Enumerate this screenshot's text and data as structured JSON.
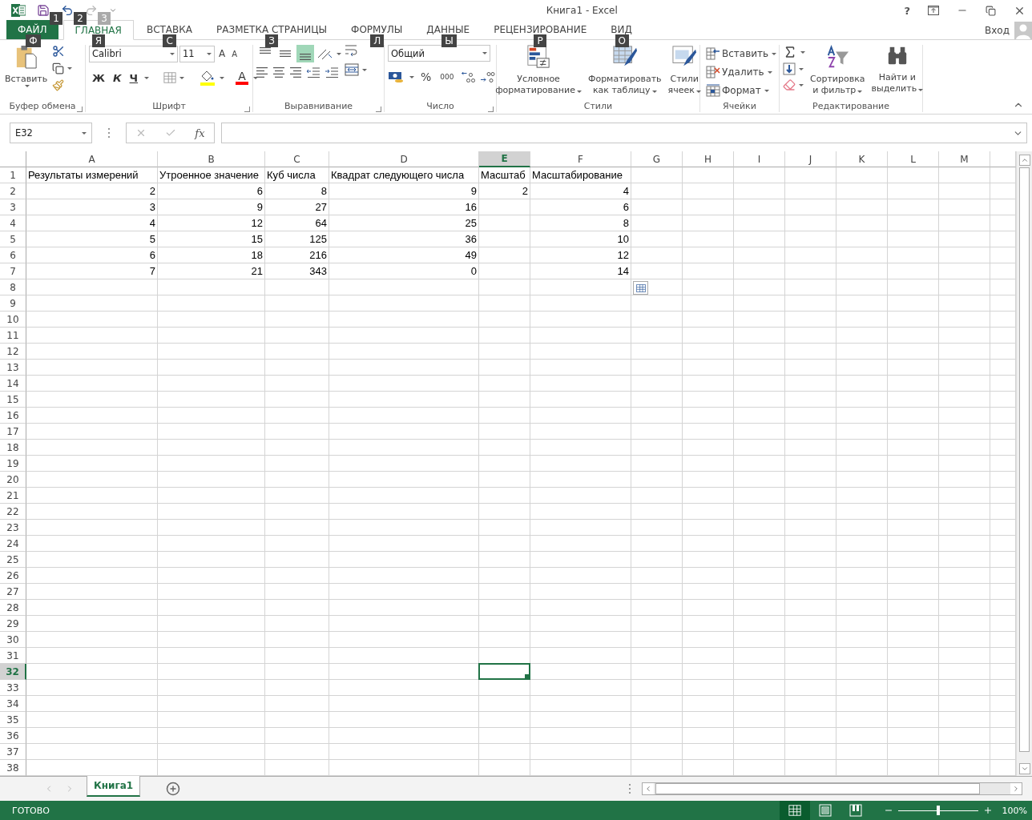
{
  "title_bar": {
    "title": "Книга1 - Excel",
    "help": "?",
    "quick_access": [
      {
        "kind": "save",
        "keytip": "1",
        "disabled": false
      },
      {
        "kind": "undo",
        "keytip": "2",
        "disabled": false
      },
      {
        "kind": "redo",
        "keytip": "3",
        "disabled": true
      }
    ]
  },
  "tabs": [
    {
      "label": "ФАЙЛ",
      "kind": "file",
      "selected": false,
      "keytip": "Ф"
    },
    {
      "label": "ГЛАВНАЯ",
      "kind": "tab",
      "selected": true,
      "keytip": "Я"
    },
    {
      "label": "ВСТАВКА",
      "kind": "tab",
      "selected": false,
      "keytip": "С"
    },
    {
      "label": "РАЗМЕТКА СТРАНИЦЫ",
      "kind": "tab",
      "selected": false,
      "keytip": "З"
    },
    {
      "label": "ФОРМУЛЫ",
      "kind": "tab",
      "selected": false,
      "keytip": "Л"
    },
    {
      "label": "ДАННЫЕ",
      "kind": "tab",
      "selected": false,
      "keytip": "Ы"
    },
    {
      "label": "РЕЦЕНЗИРОВАНИЕ",
      "kind": "tab",
      "selected": false,
      "keytip": "Р"
    },
    {
      "label": "ВИД",
      "kind": "tab",
      "selected": false,
      "keytip": "О"
    }
  ],
  "account": {
    "label": "Вход"
  },
  "ribbon": {
    "clipboard": {
      "paste": "Вставить",
      "label": "Буфер обмена"
    },
    "font": {
      "name": "Calibri",
      "size": "11",
      "grow": "A",
      "shrink": "A",
      "bold": "Ж",
      "italic": "К",
      "underline": "Ч",
      "font_color": "A",
      "label": "Шрифт"
    },
    "alignment": {
      "vertical": [
        {
          "kind": "top",
          "selected": false
        },
        {
          "kind": "middle",
          "selected": false
        },
        {
          "kind": "bottom",
          "selected": true
        }
      ],
      "label": "Выравнивание"
    },
    "number": {
      "format": "Общий",
      "percent": "%",
      "thousands": "000",
      "label": "Число"
    },
    "styles": {
      "buttons": [
        {
          "kind": "conditional",
          "lines": [
            "Условное",
            "форматирование"
          ]
        },
        {
          "kind": "table",
          "lines": [
            "Форматировать",
            "как таблицу"
          ]
        },
        {
          "kind": "cell",
          "lines": [
            "Стили",
            "ячеек"
          ]
        }
      ],
      "label": "Стили"
    },
    "cells": {
      "buttons": [
        {
          "kind": "insert",
          "label": "Вставить"
        },
        {
          "kind": "delete",
          "label": "Удалить"
        },
        {
          "kind": "format",
          "label": "Формат"
        }
      ],
      "label": "Ячейки"
    },
    "editing": {
      "buttons": [
        {
          "kind": "sort",
          "lines": [
            "Сортировка",
            "и фильтр"
          ]
        },
        {
          "kind": "find",
          "lines": [
            "Найти и",
            "выделить"
          ]
        }
      ],
      "label": "Редактирование"
    }
  },
  "formula_bar": {
    "name_box": "E32",
    "fx": "fx"
  },
  "columns": [
    {
      "label": "A",
      "selected": false
    },
    {
      "label": "B",
      "selected": false
    },
    {
      "label": "C",
      "selected": false
    },
    {
      "label": "D",
      "selected": false
    },
    {
      "label": "E",
      "selected": true
    },
    {
      "label": "F",
      "selected": false
    },
    {
      "label": "G",
      "selected": false
    },
    {
      "label": "H",
      "selected": false
    },
    {
      "label": "I",
      "selected": false
    },
    {
      "label": "J",
      "selected": false
    },
    {
      "label": "K",
      "selected": false
    },
    {
      "label": "L",
      "selected": false
    },
    {
      "label": "M",
      "selected": false
    }
  ],
  "rows": [
    {
      "label": "1",
      "selected": false,
      "cells": [
        "Результаты измерений",
        "Утроенное значение",
        "Куб числа",
        "Квадрат следующего числа",
        "Масштаб",
        "Масштабирование"
      ]
    },
    {
      "label": "2",
      "selected": false,
      "cells": [
        "2",
        "6",
        "8",
        "9",
        "2",
        "4"
      ]
    },
    {
      "label": "3",
      "selected": false,
      "cells": [
        "3",
        "9",
        "27",
        "16",
        null,
        "6"
      ]
    },
    {
      "label": "4",
      "selected": false,
      "cells": [
        "4",
        "12",
        "64",
        "25",
        null,
        "8"
      ]
    },
    {
      "label": "5",
      "selected": false,
      "cells": [
        "5",
        "15",
        "125",
        "36",
        null,
        "10"
      ]
    },
    {
      "label": "6",
      "selected": false,
      "cells": [
        "6",
        "18",
        "216",
        "49",
        null,
        "12"
      ]
    },
    {
      "label": "7",
      "selected": false,
      "cells": [
        "7",
        "21",
        "343",
        "0",
        null,
        "14"
      ]
    },
    {
      "label": "8",
      "selected": false
    },
    {
      "label": "9",
      "selected": false
    },
    {
      "label": "10",
      "selected": false
    },
    {
      "label": "11",
      "selected": false
    },
    {
      "label": "12",
      "selected": false
    },
    {
      "label": "13",
      "selected": false
    },
    {
      "label": "14",
      "selected": false
    },
    {
      "label": "15",
      "selected": false
    },
    {
      "label": "16",
      "selected": false
    },
    {
      "label": "17",
      "selected": false
    },
    {
      "label": "18",
      "selected": false
    },
    {
      "label": "19",
      "selected": false
    },
    {
      "label": "20",
      "selected": false
    },
    {
      "label": "21",
      "selected": false
    },
    {
      "label": "22",
      "selected": false
    },
    {
      "label": "23",
      "selected": false
    },
    {
      "label": "24",
      "selected": false
    },
    {
      "label": "25",
      "selected": false
    },
    {
      "label": "26",
      "selected": false
    },
    {
      "label": "27",
      "selected": false
    },
    {
      "label": "28",
      "selected": false
    },
    {
      "label": "29",
      "selected": false
    },
    {
      "label": "30",
      "selected": false
    },
    {
      "label": "31",
      "selected": false
    },
    {
      "label": "32",
      "selected": true
    },
    {
      "label": "33",
      "selected": false
    },
    {
      "label": "34",
      "selected": false
    },
    {
      "label": "35",
      "selected": false
    },
    {
      "label": "36",
      "selected": false
    },
    {
      "label": "37",
      "selected": false
    },
    {
      "label": "38",
      "selected": false
    }
  ],
  "sheets": [
    {
      "label": "Книга1",
      "selected": true
    }
  ],
  "status_bar": {
    "text": "ГОТОВО",
    "views": [
      {
        "kind": "normal",
        "selected": true
      },
      {
        "kind": "page_layout",
        "selected": false
      },
      {
        "kind": "page_break",
        "selected": false
      }
    ],
    "zoom": {
      "level": 0.5,
      "reading": "100%"
    }
  }
}
